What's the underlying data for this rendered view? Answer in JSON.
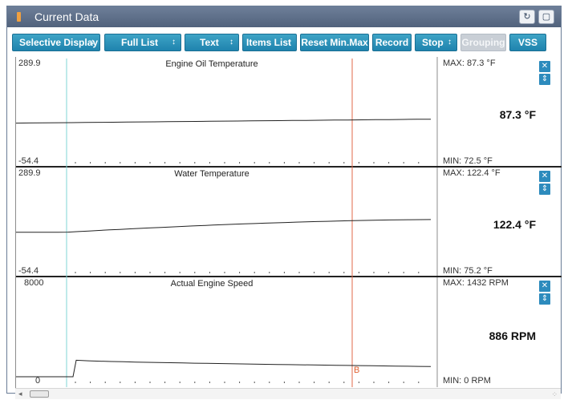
{
  "window": {
    "title": "Current Data"
  },
  "toolbar": {
    "selective_display": "Selective Display",
    "full_list": "Full List",
    "text": "Text",
    "items_list": "Items List",
    "reset_min_max": "Reset Min.Max",
    "record": "Record",
    "stop": "Stop",
    "grouping": "Grouping",
    "vss": "VSS",
    "spinner_glyph": "↕"
  },
  "icons": {
    "retry": "retry-icon",
    "restore": "restore-window-icon",
    "close": "close-icon",
    "expand": "expand-icon"
  },
  "panels": [
    {
      "title": "Engine Oil Temperature",
      "axis_max": "289.9",
      "axis_min": "-54.4",
      "max_text": "MAX:  87.3 °F",
      "min_text": "MIN:  72.5 °F",
      "current": "87.3 °F",
      "trace": {
        "start": 72.5,
        "end": 87.3,
        "ymin": -54.4,
        "ymax": 289.9
      }
    },
    {
      "title": "Water Temperature",
      "axis_max": "289.9",
      "axis_min": "-54.4",
      "max_text": "MAX: 122.4 °F",
      "min_text": "MIN:  75.2 °F",
      "current": "122.4 °F",
      "trace": {
        "start": 75.2,
        "end": 122.4,
        "ymin": -54.4,
        "ymax": 289.9
      }
    },
    {
      "title": "Actual Engine Speed",
      "axis_max": "8000",
      "axis_min": "0",
      "max_text": "MAX:  1432 RPM",
      "min_text": "MIN:     0 RPM",
      "current": "886 RPM",
      "trace": {
        "start": 0,
        "peak": 1432,
        "end": 886,
        "ymin": 0,
        "ymax": 8000
      }
    }
  ],
  "markers": {
    "b_label": "B",
    "cursor_color": "#e06a4a",
    "start_color": "#7fd6d6"
  }
}
